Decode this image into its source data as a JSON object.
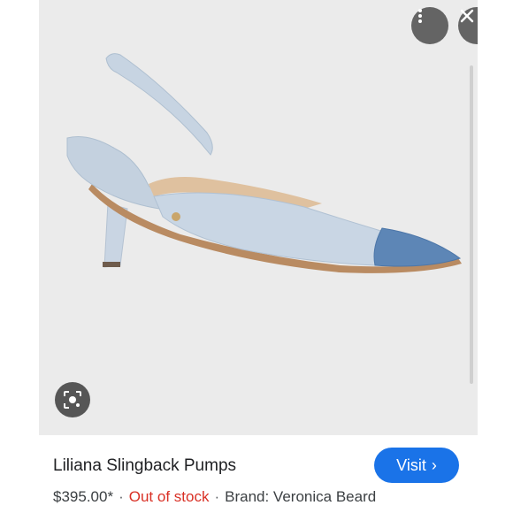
{
  "product": {
    "title": "Liliana Slingback Pumps",
    "price": "$395.00*",
    "separator": "·",
    "stock_status": "Out of stock",
    "brand": "Brand: Veronica Beard"
  },
  "actions": {
    "visit_label": "Visit",
    "visit_icon": "chevron-right-icon",
    "more_icon": "more-vert-icon",
    "close_icon": "close-icon",
    "lens_icon": "lens-search-icon"
  },
  "colors": {
    "accent": "#1a73e8",
    "stock_status": "#d93025",
    "image_background": "#ebebeb"
  }
}
